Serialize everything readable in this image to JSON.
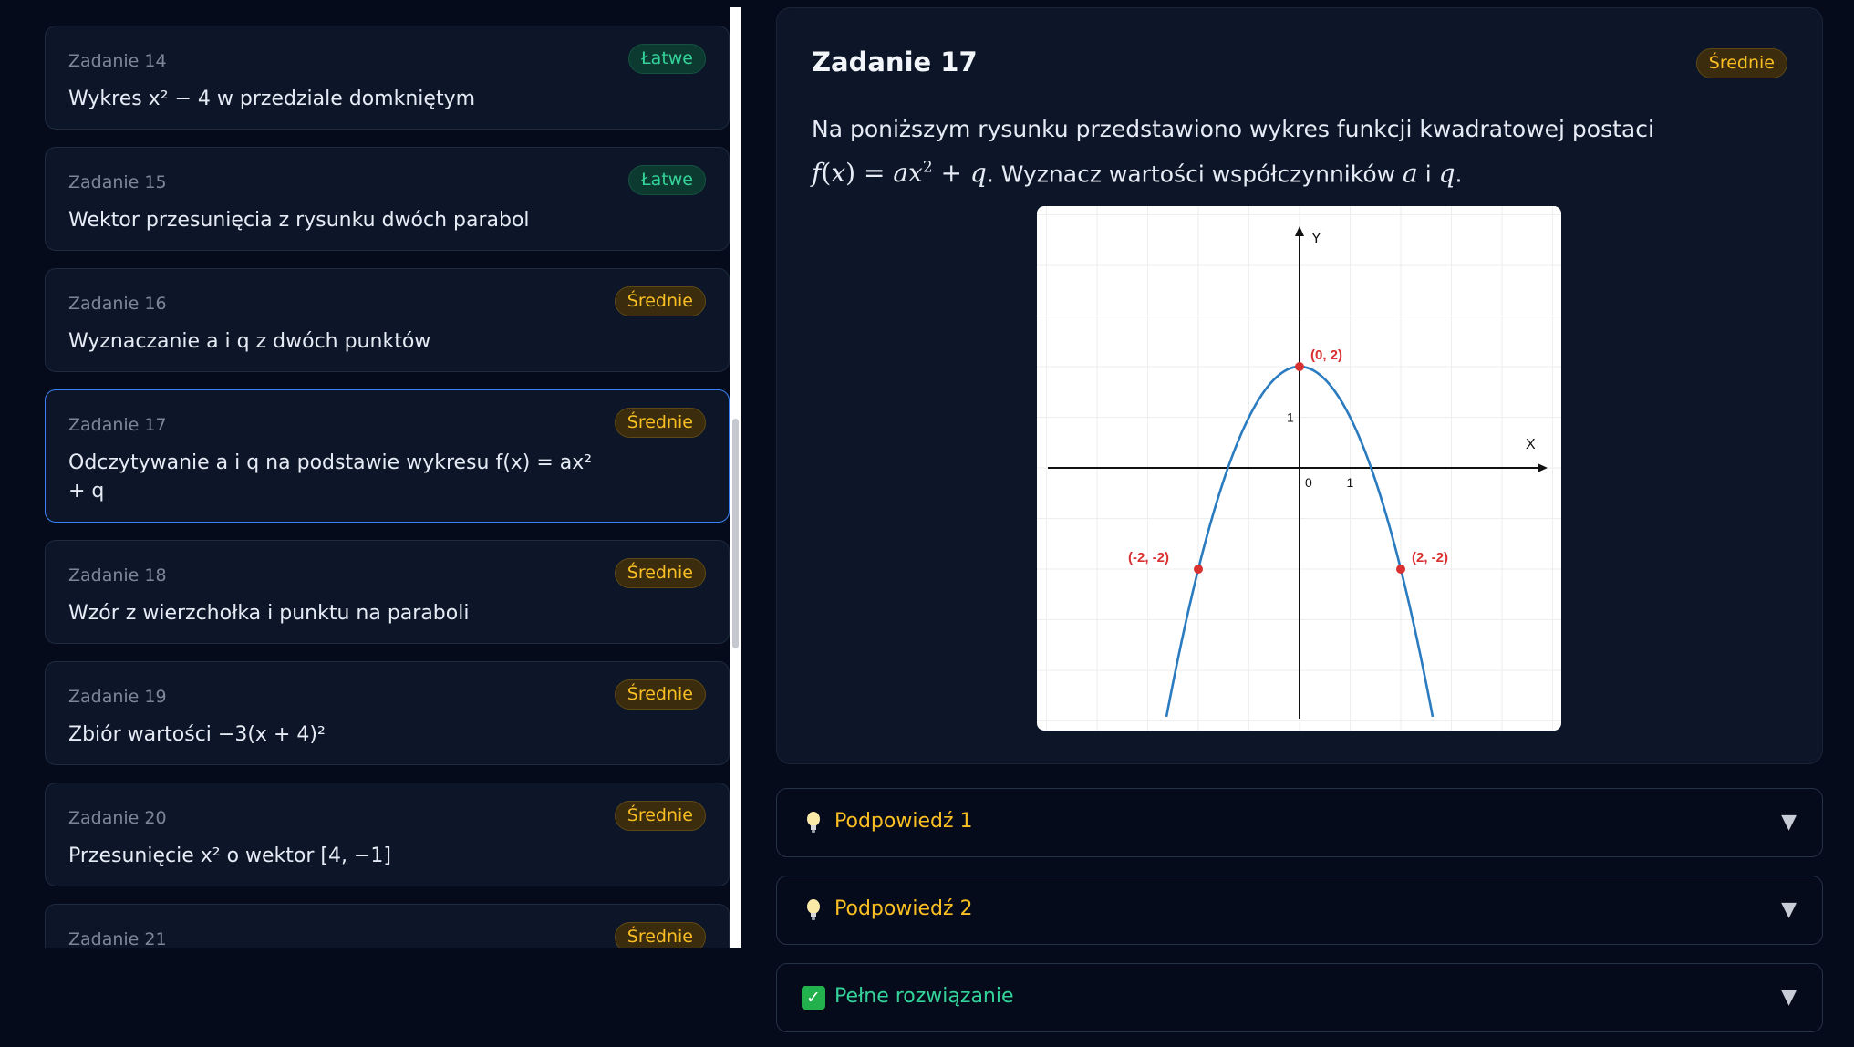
{
  "tasks": [
    {
      "num": "Zadanie 14",
      "title": "Wykres x² − 4 w przedziale domkniętym",
      "badge": "Łatwe",
      "level": "easy"
    },
    {
      "num": "Zadanie 15",
      "title": "Wektor przesunięcia z rysunku dwóch parabol",
      "badge": "Łatwe",
      "level": "easy"
    },
    {
      "num": "Zadanie 16",
      "title": "Wyznaczanie a i q z dwóch punktów",
      "badge": "Średnie",
      "level": "medium"
    },
    {
      "num": "Zadanie 17",
      "title": "Odczytywanie a i q na podstawie wykresu f(x) = ax² + q",
      "badge": "Średnie",
      "level": "medium"
    },
    {
      "num": "Zadanie 18",
      "title": "Wzór z wierzchołka i punktu na paraboli",
      "badge": "Średnie",
      "level": "medium"
    },
    {
      "num": "Zadanie 19",
      "title": "Zbiór wartości −3(x + 4)²",
      "badge": "Średnie",
      "level": "medium"
    },
    {
      "num": "Zadanie 20",
      "title": "Przesunięcie x² o wektor [4, −1]",
      "badge": "Średnie",
      "level": "medium"
    },
    {
      "num": "Zadanie 21",
      "title": "",
      "badge": "Średnie",
      "level": "medium"
    }
  ],
  "problem": {
    "title": "Zadanie 17",
    "badge": "Średnie",
    "text_line1": "Na poniższym rysunku przedstawiono wykres funkcji kwadratowej postaci",
    "text_mid": ". Wyznacz wartości współczynników ",
    "text_and": " i ",
    "text_end": "."
  },
  "graph": {
    "x_label": "X",
    "y_label": "Y",
    "origin_label": "0",
    "x_unit_label": "1",
    "y_unit_label": "1",
    "points": [
      {
        "label": "(0, 2)",
        "x": 0,
        "y": 2
      },
      {
        "label": "(-2, -2)",
        "x": -2,
        "y": -2
      },
      {
        "label": "(2, -2)",
        "x": 2,
        "y": -2
      }
    ],
    "a": -1,
    "q": 2,
    "curve_color": "#2a7bbf",
    "point_color": "#d93030"
  },
  "accordions": [
    {
      "label": "Podpowiedź 1",
      "icon": "lightbulb-icon"
    },
    {
      "label": "Podpowiedź 2",
      "icon": "lightbulb-icon"
    },
    {
      "label": "Pełne rozwiązanie",
      "icon": "check-icon"
    }
  ],
  "colors": {
    "background": "#050b1a",
    "card": "#0d1628",
    "active_border": "#3b82f6",
    "easy": "#34d399",
    "medium": "#fbbf24"
  }
}
